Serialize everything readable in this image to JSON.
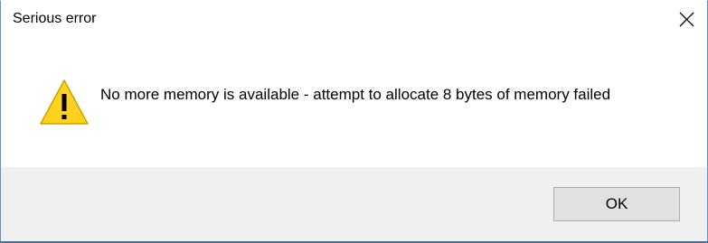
{
  "window": {
    "title": "Serious error",
    "close_icon": "close-icon"
  },
  "message": {
    "icon": "warning-icon",
    "text": "No more memory is available - attempt to allocate 8 bytes of memory failed"
  },
  "buttons": {
    "ok_label": "OK"
  },
  "colors": {
    "warning_fill": "#ffd21f",
    "warning_outline": "#c8a200",
    "footer_bg": "#f0f0f0",
    "button_bg": "#e1e1e1",
    "button_border": "#adadad"
  }
}
